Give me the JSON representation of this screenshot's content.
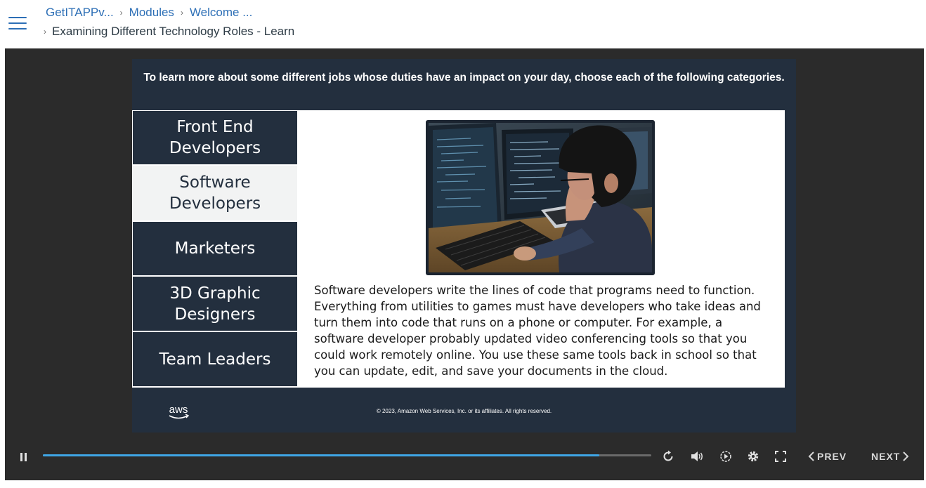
{
  "header": {
    "breadcrumbs": [
      "GetITAPPv...",
      "Modules",
      "Welcome ..."
    ],
    "current_page": "Examining Different Technology Roles - Learn"
  },
  "slide": {
    "instruction": "To learn more about some different jobs whose duties have an impact on your day, choose each of the following categories.",
    "tabs": [
      {
        "line1": "Front End",
        "line2": "Developers"
      },
      {
        "line1": "Software",
        "line2": "Developers"
      },
      {
        "line1": "Marketers",
        "line2": ""
      },
      {
        "line1": "3D Graphic",
        "line2": "Designers"
      },
      {
        "line1": "Team Leaders",
        "line2": ""
      }
    ],
    "active_tab": "Software Developers",
    "description": "Software developers write the lines of code that programs need to function. Everything from utilities to games must have developers who take ideas and turn them into code that runs on a phone or computer. For example, a software developer probably updated video conferencing tools so that you could work remotely online. You use these same tools back in school so that you can update, edit, and save your documents in the cloud.",
    "logo_text": "aws",
    "copyright": "© 2023, Amazon Web Services, Inc. or its affiliates. All rights reserved."
  },
  "player": {
    "progress_fraction": 0.915,
    "prev_label": "PREV",
    "next_label": "NEXT"
  },
  "colors": {
    "brand_link": "#2d6fb6",
    "slide_navy": "#232f3e",
    "progress_blue": "#3fa6e6",
    "player_bg": "#2b2b2b"
  },
  "icons": [
    "hamburger-icon",
    "breadcrumb-chevron-icon",
    "pause-icon",
    "replay-icon",
    "volume-icon",
    "playback-speed-icon",
    "settings-gear-icon",
    "fullscreen-icon",
    "chevron-left-icon",
    "chevron-right-icon",
    "aws-logo-icon"
  ]
}
